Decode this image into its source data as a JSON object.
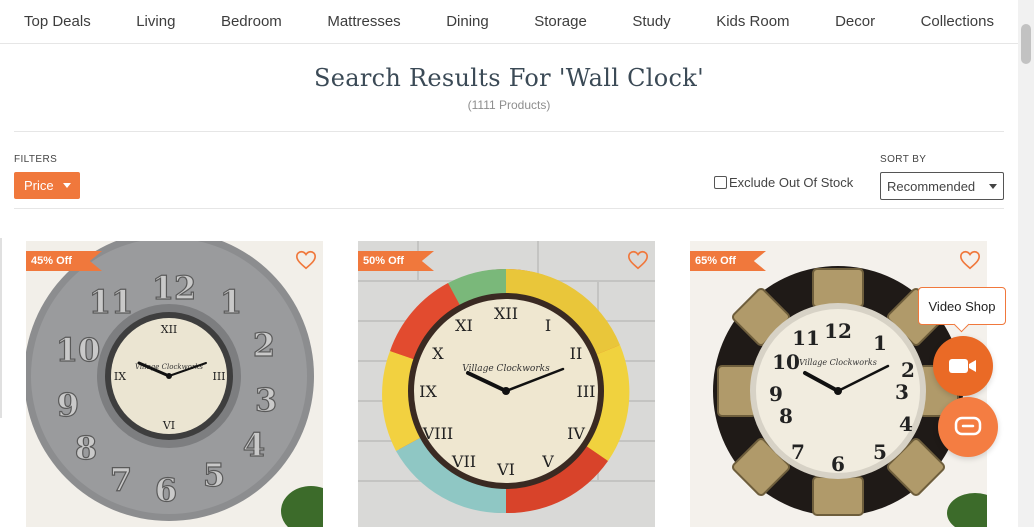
{
  "nav": {
    "items": [
      "Top Deals",
      "Living",
      "Bedroom",
      "Mattresses",
      "Dining",
      "Storage",
      "Study",
      "Kids Room",
      "Decor",
      "Collections"
    ]
  },
  "search": {
    "title": "Search Results For 'Wall Clock'",
    "count": "(1111 Products)"
  },
  "filters": {
    "label": "FILTERS",
    "price_label": "Price"
  },
  "exclude_out_of_stock": {
    "label": "Exclude Out Of Stock",
    "checked": false
  },
  "sort": {
    "label": "SORT BY",
    "selected": "Recommended"
  },
  "products": [
    {
      "badge": "45% Off",
      "dial_text": "Village Clockworks",
      "dial_subtext": "Birmingham est. 1792"
    },
    {
      "badge": "50% Off",
      "dial_text": "Village Clockworks",
      "dial_subtext": "Birmingham est. 1792"
    },
    {
      "badge": "65% Off",
      "dial_text": "Village Clockworks",
      "dial_subtext": "Birmingham est. 1792"
    }
  ],
  "widgets": {
    "video_shop_label": "Video Shop"
  },
  "colors": {
    "accent": "#f0783c",
    "heading": "#3b4a56"
  },
  "icons": {
    "caret": "chevron-down-icon",
    "wishlist": "heart-icon",
    "video": "video-camera-icon",
    "chat": "chat-bubble-icon"
  }
}
